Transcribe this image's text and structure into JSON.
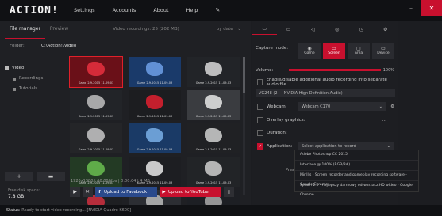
{
  "app": {
    "logo": "ACTION!",
    "menu": [
      "Settings",
      "Accounts",
      "About",
      "Help"
    ],
    "brush_icon": "brush-icon",
    "min_label": "–",
    "close_label": "✕"
  },
  "left": {
    "tab_file_manager": "File manager",
    "tab_preview": "Preview",
    "video_count": "Video recordings: 25 (202 MB)",
    "sort": "by date",
    "sort_arrow": "⌄",
    "folder_label": "Folder:",
    "folder_path": "C:\\Action!\\Video",
    "folder_more": "...",
    "tree": [
      {
        "label": "Video",
        "sub": false
      },
      {
        "label": "Recordings",
        "sub": true
      },
      {
        "label": "Tutorials",
        "sub": true
      }
    ],
    "add_label": "+",
    "folder_btn_label": "▬",
    "disk_label": "Free disk space:",
    "disk_value": "7.8 GB",
    "file_info": "1920x1080 | 60.000fps | 0:00:04 | 4 MB",
    "play_label": "▶",
    "delete_label": "✕",
    "fb_icon": "f",
    "fb_label": "Upload to Facebook",
    "yt_icon": "▶",
    "yt_label": "Upload to YouTube",
    "upload_label": "⬆"
  },
  "thumbs": [
    {
      "caption": "Game 2-9-2015 11-09-03",
      "bg": "#6a1018",
      "accent": "#e83040"
    },
    {
      "caption": "Game 2-9-2015 11-09-03",
      "bg": "#1a3a6a",
      "accent": "#6fa0e8"
    },
    {
      "caption": "Game 2-9-2015 11-09-03",
      "bg": "#222428",
      "accent": "#d8d8d8"
    },
    {
      "caption": "Game 2-9-2015 11-09-03",
      "bg": "#222428",
      "accent": "#c0c0c0"
    },
    {
      "caption": "Game 2-9-2015 11-09-03",
      "bg": "#1c1d20",
      "accent": "#e02030"
    },
    {
      "caption": "Game 2-9-2015 11-09-03",
      "bg": "#3a3c40",
      "accent": "#e8e8e8"
    },
    {
      "caption": "Game 2-9-2015 11-09-03",
      "bg": "#242528",
      "accent": "#c8c8c8"
    },
    {
      "caption": "Game 2-9-2015 11-09-03",
      "bg": "#1a3a66",
      "accent": "#7ab0e8"
    },
    {
      "caption": "Game 2-9-2015 11-09-03",
      "bg": "#202124",
      "accent": "#d0d0d0"
    },
    {
      "caption": "Game 2-9-2015 11-09-03",
      "bg": "#233a24",
      "accent": "#6ac050"
    },
    {
      "caption": "Game 2-9-2015 11-09-03",
      "bg": "#1d1e22",
      "accent": "#e8e8e8"
    },
    {
      "caption": "Game 2-9-2015 11-09-03",
      "bg": "#222427",
      "accent": "#cfcfcf"
    },
    {
      "caption": "",
      "bg": "#1e1f22",
      "accent": "#d03040"
    },
    {
      "caption": "",
      "bg": "#2c2e33",
      "accent": "#bbbbbb"
    },
    {
      "caption": "",
      "bg": "#1d1f24",
      "accent": "#aaaaaa"
    }
  ],
  "right": {
    "tabs": [
      "▭",
      "▭",
      "◁",
      "◎",
      "◷",
      "⚙"
    ],
    "capture_label": "Capture mode:",
    "modes": [
      {
        "label": "Game",
        "glyph": "◉"
      },
      {
        "label": "Screen",
        "glyph": "▭"
      },
      {
        "label": "Area",
        "glyph": "▢"
      },
      {
        "label": "Device",
        "glyph": "▭"
      }
    ],
    "volume_label": "Volume:",
    "volume_pct": "100%",
    "volume_level": 1.0,
    "separate_audio": "Enable/disable additional audio recording into separate audio file.",
    "audio_device": "VG248 (2 — NVIDIA High Definition Audio)",
    "webcam_label": "Webcam:",
    "webcam_value": "Webcam C170",
    "overlay_label": "Overlay graphics:",
    "overlay_value": "...",
    "duration_label": "Duration:",
    "application_label": "Application:",
    "application_value": "Select application to record",
    "press_caption": "Press"
  },
  "popup": {
    "options": [
      "Adobe Photoshop CC 2015",
      "Interface @ 100% (RGB/8#)",
      "Mirillis - Screen recorder and gameplay recording software - Google Chrome",
      "Splash 2.0 - najlepszy darmowy odtwarzacz HD wideo - Google Chrome"
    ]
  },
  "status": {
    "label": "Status:",
    "text": "Ready to start video recording...  [NVIDIA Quadro K600]"
  }
}
